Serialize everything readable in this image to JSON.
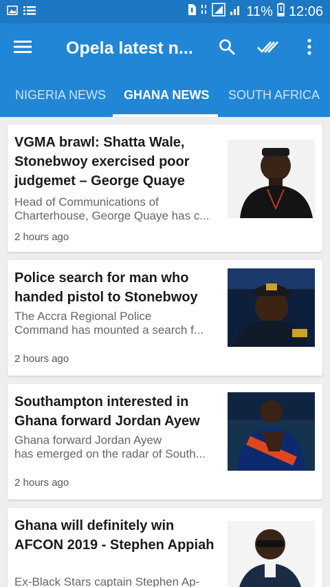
{
  "status_bar": {
    "battery_percent": "11%",
    "time": "12:06"
  },
  "toolbar": {
    "title": "Opela latest n..."
  },
  "tabs": [
    {
      "label": "NIGERIA NEWS",
      "selected": false
    },
    {
      "label": "GHANA NEWS",
      "selected": true
    },
    {
      "label": "SOUTH AFRICA",
      "selected": false
    }
  ],
  "articles": [
    {
      "headline": "VGMA brawl: Shatta Wale, Stonebwoy exercised poor judgemet – George Quaye",
      "summary_line1": "Head of Communications of",
      "summary_line2": "Charterhouse, George Quaye has c...",
      "time": "2 hours ago"
    },
    {
      "headline": "Police search for man who handed pistol to Stonebwoy",
      "summary_line1": "The Accra Regional Police",
      "summary_line2": "Command has mounted a search f...",
      "time": "2 hours ago"
    },
    {
      "headline": "Southampton interested in Ghana forward Jordan Ayew",
      "summary_line1": "Ghana forward Jordan Ayew",
      "summary_line2": "has emerged on the radar of South...",
      "time": "2 hours ago"
    },
    {
      "headline": "Ghana will definitely win AFCON 2019 - Stephen Appiah",
      "summary_line1": "Ex-Black Stars captain Stephen Ap-",
      "summary_line2": "",
      "time": ""
    }
  ],
  "colors": {
    "status_bar": "#1e77c2",
    "app_bar": "#2186d6",
    "background": "#eeeeee"
  }
}
